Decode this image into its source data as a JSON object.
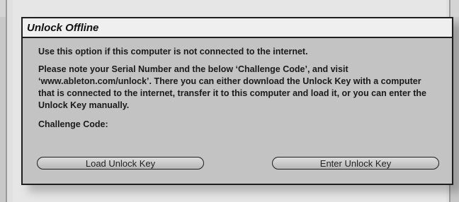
{
  "dialog": {
    "title": "Unlock Offline",
    "paragraph1": "Use this option if this computer is not connected to the internet.",
    "paragraph2": "Please note your Serial Number and the below ‘Challenge Code’, and visit ‘www.ableton.com/unlock’. There you can either download the Unlock Key with a computer that is connected to the internet, transfer it to this computer and load it, or you can enter the Unlock Key manually.",
    "challenge_label": "Challenge Code:",
    "load_button": "Load Unlock Key",
    "enter_button": "Enter Unlock Key"
  }
}
